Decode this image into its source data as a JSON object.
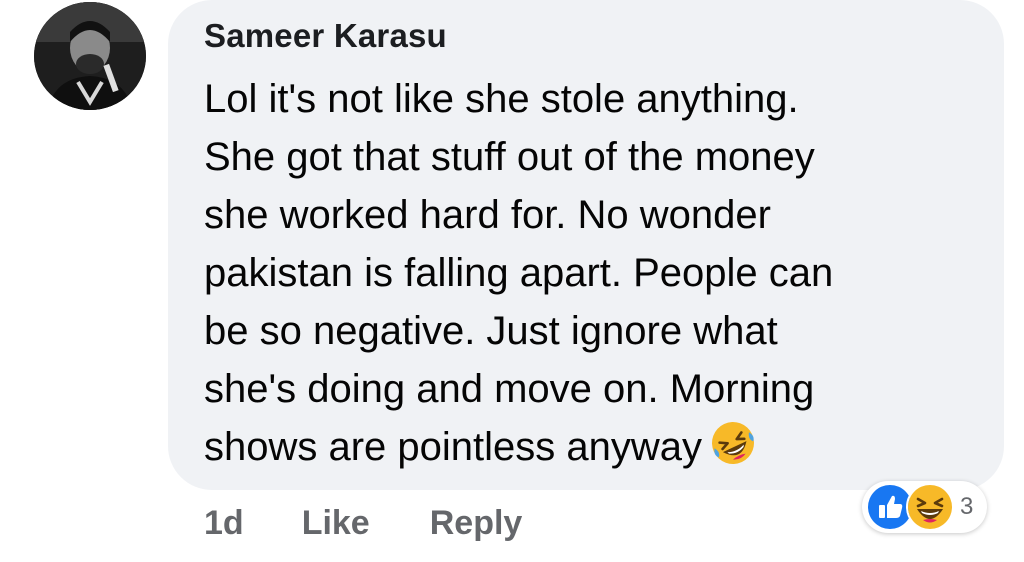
{
  "comment": {
    "author": "Sameer Karasu",
    "text_lines": [
      "Lol it's not like she stole anything.",
      "She got that stuff out of the money",
      "she worked hard for. No wonder",
      "pakistan is falling apart. People can",
      "be so negative. Just ignore what",
      "she's doing and move on. Morning",
      "shows are pointless anyway"
    ],
    "trailing_emoji": "rolling-on-floor-laughing-emoji"
  },
  "actions": {
    "timestamp": "1d",
    "like_label": "Like",
    "reply_label": "Reply"
  },
  "reactions": {
    "icons": [
      "like-reaction-icon",
      "haha-reaction-icon"
    ],
    "count": "3"
  },
  "colors": {
    "bubble": "#f0f2f5",
    "action_text": "#65676b",
    "like_blue": "#1877f2",
    "haha_yellow": "#f7b928"
  }
}
